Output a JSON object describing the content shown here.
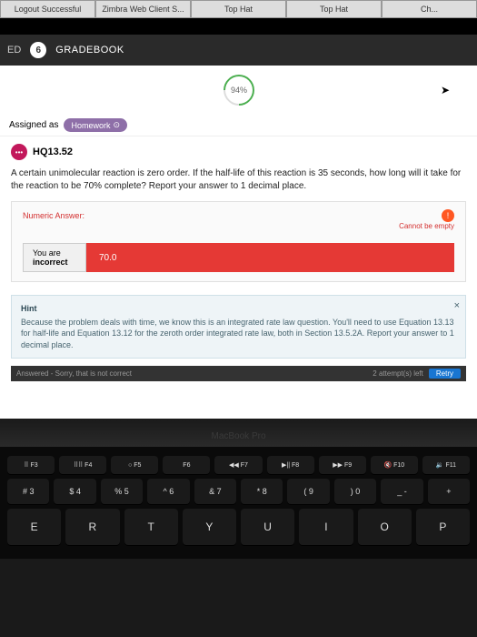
{
  "tabs": [
    "Logout Successful",
    "Zimbra Web Client S...",
    "Top Hat",
    "Top Hat",
    "Ch..."
  ],
  "nav": {
    "ed": "ED",
    "count": "6",
    "section": "GRADEBOOK"
  },
  "progress": "94%",
  "assigned": {
    "label": "Assigned as",
    "pill": "Homework",
    "pill_icon": "⊙"
  },
  "question": {
    "badge": "•••",
    "id": "HQ13.52",
    "text": "A certain unimolecular reaction is zero order. If the half-life of this reaction is 35 seconds, how long will it take for the reaction to be 70% complete? Report your answer to 1 decimal place."
  },
  "answer": {
    "label": "Numeric Answer:",
    "empty": "Cannot be empty",
    "incorrect_l1": "You are",
    "incorrect_l2": "incorrect",
    "value": "70.0"
  },
  "hint": {
    "title": "Hint",
    "body": "Because the problem deals with time, we know this is an integrated rate law question. You'll need to use Equation 13.13 for half-life and Equation 13.12 for the zeroth order integrated rate law, both in Section 13.5.2A. Report your answer to 1 decimal place."
  },
  "footer": {
    "left": "Answered - Sorry, that is not correct",
    "right": "2 attempt(s) left",
    "retry": "Retry"
  },
  "laptop": "MacBook Pro",
  "keys": {
    "fn": [
      "⠿ F3",
      "⠿⠿ F4",
      "○ F5",
      "F6",
      "◀◀ F7",
      "▶|| F8",
      "▶▶ F9",
      "🔇 F10",
      "🔉 F11"
    ],
    "num": [
      "# 3",
      "$ 4",
      "% 5",
      "^ 6",
      "& 7",
      "* 8",
      "( 9",
      ") 0",
      "_ -",
      "+"
    ],
    "letters": [
      "E",
      "R",
      "T",
      "Y",
      "U",
      "I",
      "O",
      "P"
    ]
  }
}
